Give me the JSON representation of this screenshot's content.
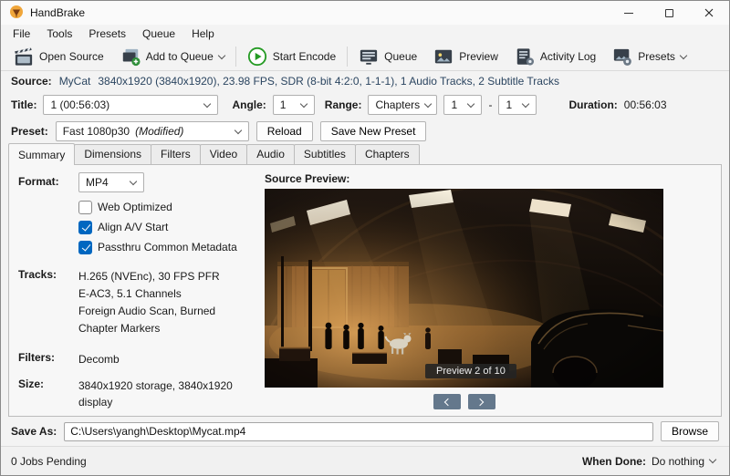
{
  "window": {
    "title": "HandBrake",
    "controls": [
      "minimize",
      "maximize",
      "close"
    ]
  },
  "menu": {
    "items": [
      "File",
      "Tools",
      "Presets",
      "Queue",
      "Help"
    ]
  },
  "toolbar": {
    "open_source": "Open Source",
    "add_to_queue": "Add to Queue",
    "start_encode": "Start Encode",
    "queue": "Queue",
    "preview": "Preview",
    "activity_log": "Activity Log",
    "presets": "Presets"
  },
  "icons": {
    "handbrake-logo-icon": "handbrake-drink",
    "open-source-icon": "clapperboard",
    "add-to-queue-icon": "stacked-frames-plus",
    "start-encode-icon": "green-play-circle",
    "queue-icon": "list-monitor",
    "preview-icon": "picture",
    "activity-log-icon": "document-gear",
    "presets-icon": "picture-gear"
  },
  "source": {
    "label": "Source:",
    "name": "MyCat",
    "details": "3840x1920 (3840x1920), 23.98 FPS, SDR (8-bit 4:2:0, 1-1-1), 1 Audio Tracks, 2 Subtitle Tracks"
  },
  "title_row": {
    "title_label": "Title:",
    "title_value": "1 (00:56:03)",
    "angle_label": "Angle:",
    "angle_value": "1",
    "range_label": "Range:",
    "range_type": "Chapters",
    "range_from": "1",
    "range_separator": "-",
    "range_to": "1",
    "duration_label": "Duration:",
    "duration_value": "00:56:03"
  },
  "preset_row": {
    "label": "Preset:",
    "value": "Fast 1080p30",
    "modified": "(Modified)",
    "reload_button": "Reload",
    "save_new_preset_button": "Save New Preset"
  },
  "tabs": [
    "Summary",
    "Dimensions",
    "Filters",
    "Video",
    "Audio",
    "Subtitles",
    "Chapters"
  ],
  "active_tab": "Summary",
  "summary": {
    "format_label": "Format:",
    "format_value": "MP4",
    "checkboxes": [
      {
        "label": "Web Optimized",
        "checked": false
      },
      {
        "label": "Align A/V Start",
        "checked": true
      },
      {
        "label": "Passthru Common Metadata",
        "checked": true
      }
    ],
    "tracks_label": "Tracks:",
    "tracks": [
      "H.265 (NVEnc), 30 FPS PFR",
      "E-AC3, 5.1 Channels",
      "Foreign Audio Scan, Burned",
      "Chapter Markers"
    ],
    "filters_label": "Filters:",
    "filters_value": "Decomb",
    "size_label": "Size:",
    "size_value": "3840x1920 storage, 3840x1920 display"
  },
  "preview": {
    "label": "Source Preview:",
    "counter": "Preview 2 of 10"
  },
  "save_as": {
    "label": "Save As:",
    "value": "C:\\Users\\yangh\\Desktop\\Mycat.mp4",
    "browse_button": "Browse"
  },
  "status_bar": {
    "jobs_pending": "0 Jobs Pending",
    "when_done_label": "When Done:",
    "when_done_value": "Do nothing"
  },
  "colors": {
    "accent_blue": "#0067c0",
    "encode_green": "#259b24"
  }
}
